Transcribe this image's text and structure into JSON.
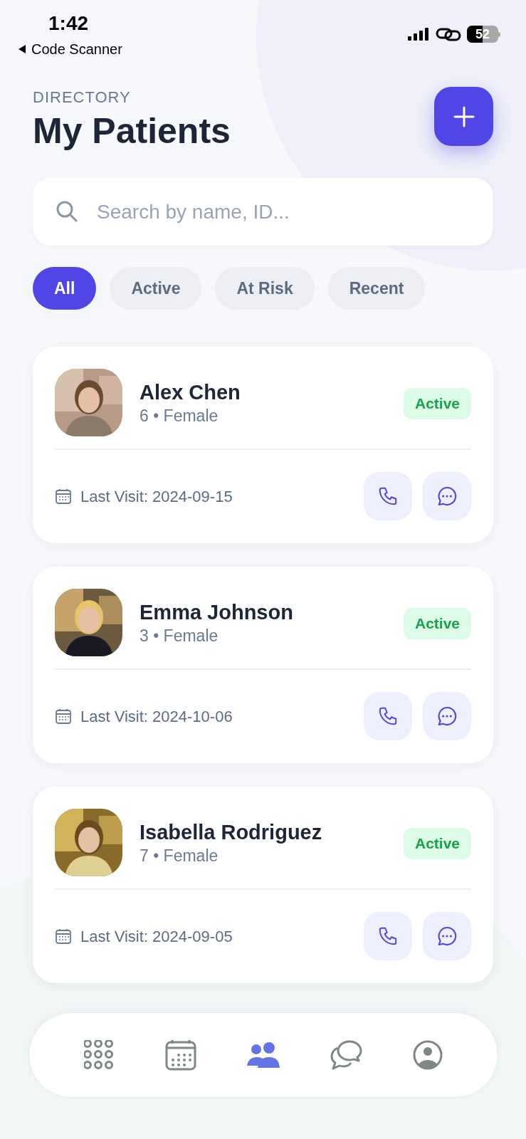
{
  "status_bar": {
    "time": "1:42",
    "back_label": "Code Scanner",
    "battery": "52"
  },
  "header": {
    "eyebrow": "DIRECTORY",
    "title": "My Patients"
  },
  "search": {
    "placeholder": "Search by name, ID..."
  },
  "filters": [
    {
      "label": "All",
      "selected": true
    },
    {
      "label": "Active",
      "selected": false
    },
    {
      "label": "At Risk",
      "selected": false
    },
    {
      "label": "Recent",
      "selected": false
    }
  ],
  "patients": [
    {
      "name": "Alex Chen",
      "meta": "6 • Female",
      "status": "Active",
      "last_visit": "Last Visit: 2024-09-15"
    },
    {
      "name": "Emma Johnson",
      "meta": "3 • Female",
      "status": "Active",
      "last_visit": "Last Visit: 2024-10-06"
    },
    {
      "name": "Isabella Rodriguez",
      "meta": "7 • Female",
      "status": "Active",
      "last_visit": "Last Visit: 2024-09-05"
    }
  ],
  "nav": [
    {
      "kind": "apps",
      "selected": false
    },
    {
      "kind": "calendar",
      "selected": false
    },
    {
      "kind": "patients",
      "selected": true
    },
    {
      "kind": "chat",
      "selected": false
    },
    {
      "kind": "profile",
      "selected": false
    }
  ]
}
